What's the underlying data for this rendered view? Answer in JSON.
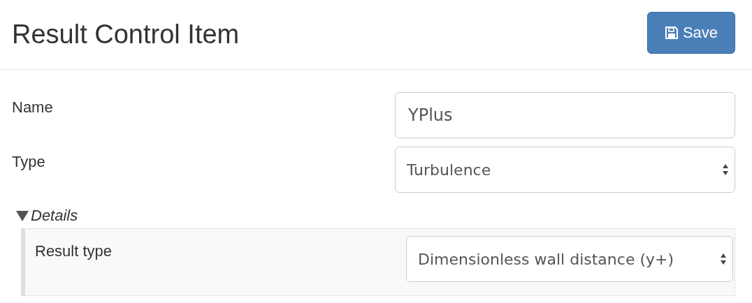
{
  "header": {
    "title": "Result Control Item",
    "save_button": "Save"
  },
  "fields": [
    {
      "label": "Name",
      "kind": "text",
      "value": "YPlus"
    },
    {
      "label": "Type",
      "kind": "select",
      "value": "Turbulence"
    }
  ],
  "details": {
    "label": "Details",
    "expanded": true,
    "fields": [
      {
        "label": "Result type",
        "kind": "select",
        "value": "Dimensionless wall distance (y+)"
      }
    ]
  }
}
